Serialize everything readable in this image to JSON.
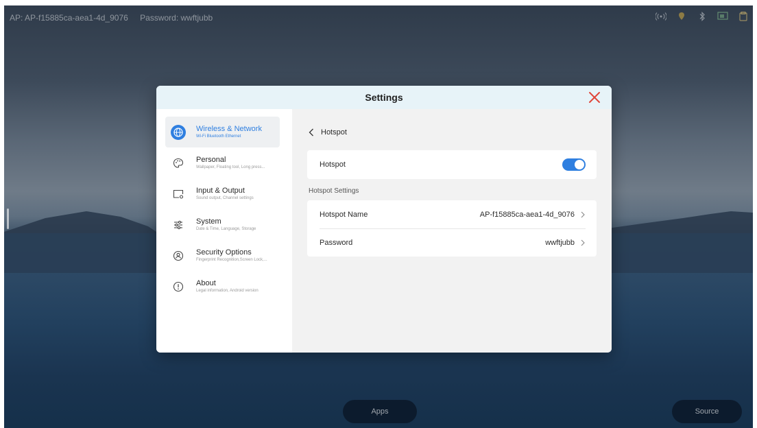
{
  "statusbar": {
    "ap_text": "AP: AP-f15885ca-aea1-4d_9076",
    "password_text": "Password: wwftjubb",
    "icons": [
      "hotspot-icon",
      "location-icon",
      "bluetooth-icon",
      "screen-share-icon",
      "storage-icon"
    ]
  },
  "dock": {
    "apps_label": "Apps",
    "source_label": "Source"
  },
  "dialog": {
    "title": "Settings",
    "close_icon": "close-icon",
    "accent_color": "#2f7fe0",
    "close_color": "#e0463a"
  },
  "sidebar": {
    "items": [
      {
        "label": "Wireless & Network",
        "sub": "Wi-Fi Bluetooth Ethernet",
        "icon": "globe-icon",
        "active": true
      },
      {
        "label": "Personal",
        "sub": "Wallpaper, Floating tool, Long press...",
        "icon": "palette-icon",
        "active": false
      },
      {
        "label": "Input & Output",
        "sub": "Sound output, Channel settings",
        "icon": "input-output-icon",
        "active": false
      },
      {
        "label": "System",
        "sub": "Date & Time, Language, Storage",
        "icon": "sliders-icon",
        "active": false
      },
      {
        "label": "Security Options",
        "sub": "Fingerprint Recognition,Screen Lock,...",
        "icon": "security-icon",
        "active": false
      },
      {
        "label": "About",
        "sub": "Legal information, Android version",
        "icon": "info-icon",
        "active": false
      }
    ]
  },
  "content": {
    "back_label": "Hotspot",
    "hotspot_toggle_label": "Hotspot",
    "hotspot_enabled": true,
    "section_title": "Hotspot Settings",
    "rows": [
      {
        "label": "Hotspot Name",
        "value": "AP-f15885ca-aea1-4d_9076"
      },
      {
        "label": "Password",
        "value": "wwftjubb"
      }
    ]
  }
}
